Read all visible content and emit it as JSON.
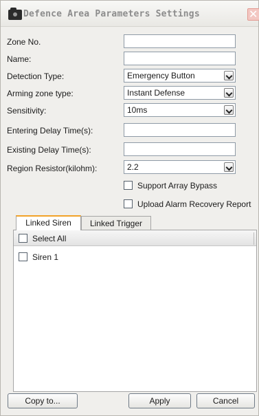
{
  "window": {
    "title": "Defence Area Parameters Settings",
    "close_glyph": "✕"
  },
  "form": {
    "zone_no": {
      "label": "Zone No.",
      "value": ""
    },
    "name": {
      "label": "Name:",
      "value": ""
    },
    "detection_type": {
      "label": "Detection Type:",
      "value": "Emergency Button"
    },
    "arming_zone_type": {
      "label": "Arming zone type:",
      "value": "Instant Defense"
    },
    "sensitivity": {
      "label": "Sensitivity:",
      "value": "10ms"
    },
    "entering_delay": {
      "label": "Entering Delay Time(s):",
      "value": ""
    },
    "existing_delay": {
      "label": "Existing Delay Time(s):",
      "value": ""
    },
    "region_resistor": {
      "label": "Region Resistor(kilohm):",
      "value": "2.2"
    },
    "support_array_bypass": {
      "label": "Support Array Bypass",
      "checked": false
    },
    "upload_alarm_recovery": {
      "label": "Upload Alarm Recovery Report",
      "checked": false
    }
  },
  "tabs": [
    {
      "label": "Linked Siren",
      "active": true
    },
    {
      "label": "Linked Trigger",
      "active": false
    }
  ],
  "list": {
    "select_all_label": "Select All",
    "items": [
      {
        "label": "Siren 1",
        "checked": false
      }
    ]
  },
  "buttons": {
    "copy_to": "Copy to...",
    "apply": "Apply",
    "cancel": "Cancel"
  },
  "colors": {
    "active_tab_accent": "#f2a227",
    "dialog_background": "#f0efec"
  },
  "icons": {
    "title": "camera-icon",
    "close": "close-icon",
    "dropdown": "chevron-down-icon"
  }
}
